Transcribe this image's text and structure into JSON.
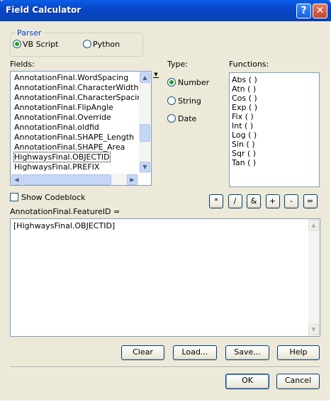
{
  "window": {
    "title": "Field Calculator",
    "help_glyph": "?",
    "close_glyph": "✕"
  },
  "parser": {
    "legend": "Parser",
    "vbscript_label": "VB Script",
    "python_label": "Python",
    "selected": "vbscript"
  },
  "fields": {
    "label": "Fields:",
    "items": [
      "AnnotationFinal.WordSpacing",
      "AnnotationFinal.CharacterWidth",
      "AnnotationFinal.CharacterSpacing",
      "AnnotationFinal.FlipAngle",
      "AnnotationFinal.Override",
      "AnnotationFinal.oldfid",
      "AnnotationFinal.SHAPE_Length",
      "AnnotationFinal.SHAPE_Area",
      "HighwaysFinal.OBJECTID",
      "HighwaysFinal.PREFIX"
    ],
    "focused_item": "HighwaysFinal.OBJECTID"
  },
  "type": {
    "label": "Type:",
    "options": [
      "Number",
      "String",
      "Date"
    ],
    "selected": "Number"
  },
  "functions": {
    "label": "Functions:",
    "items": [
      "Abs ( )",
      "Atn ( )",
      "Cos ( )",
      "Exp ( )",
      "Fix ( )",
      "Int ( )",
      "Log ( )",
      "Sin ( )",
      "Sqr ( )",
      "Tan ( )"
    ]
  },
  "show_codeblock": {
    "label": "Show Codeblock",
    "checked": false
  },
  "operators": [
    "*",
    "/",
    "&",
    "+",
    "-",
    "="
  ],
  "expression": {
    "label": "AnnotationFinal.FeatureID =",
    "value": "[HighwaysFinal.OBJECTID]"
  },
  "actions": {
    "clear": "Clear",
    "load": "Load...",
    "save": "Save...",
    "help": "Help"
  },
  "footer": {
    "ok": "OK",
    "cancel": "Cancel"
  },
  "icons": {
    "scroll_up": "▲",
    "scroll_down": "▼",
    "scroll_left": "◀",
    "scroll_right": "▶",
    "list_dropdown": "▼"
  }
}
